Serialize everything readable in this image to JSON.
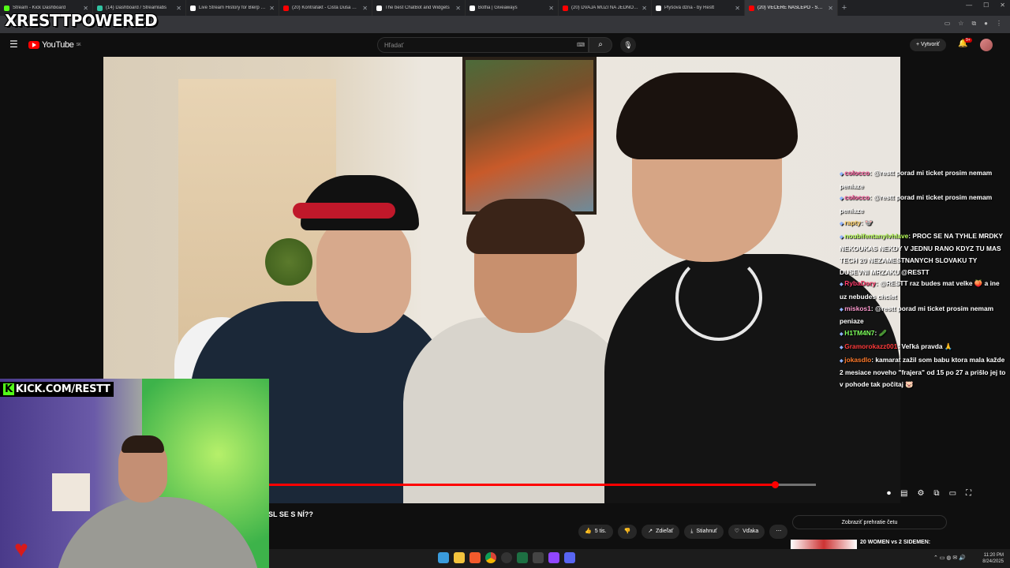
{
  "browser": {
    "tabs": [
      {
        "title": "Stream - Kick Dashboard",
        "favicon_color": "#53fc18"
      },
      {
        "title": "(14) Dashboard / Streamlabs",
        "favicon_color": "#31c3a2"
      },
      {
        "title": "Live Stream History for Blerp St...",
        "favicon_color": "#ffffff"
      },
      {
        "title": "(20) Kontrafakt - Čistá Duša pr...",
        "favicon_color": "#ff0000"
      },
      {
        "title": "The best ChatBot and Widgets",
        "favicon_color": "#ffffff"
      },
      {
        "title": "Botfia | Giveaways",
        "favicon_color": "#ffffff"
      },
      {
        "title": "(20) DVAJA MUŽI NA JEDNOM...",
        "favicon_color": "#ff0000"
      },
      {
        "title": "Plyšová dzña - by Restt",
        "favicon_color": "#ffffff"
      },
      {
        "title": "(20) VEČERE NASLEPO - STRČ...",
        "favicon_color": "#ff0000"
      }
    ],
    "active_tab": 8,
    "url_fragment": "PkC6RM"
  },
  "overlay": {
    "logo": "RESTTPOWERED",
    "kick_prefix": "K",
    "kick_text": "KICK.COM/RESTT"
  },
  "youtube": {
    "brand": "YouTube",
    "region": "SK",
    "search_placeholder": "Hľadať",
    "create_label": "Vytvoriť",
    "notifications": "9+"
  },
  "video": {
    "title": "SL SE S NÍ??",
    "progress": 0.925,
    "buffered": 1.0
  },
  "actions": {
    "likes": "5 tis.",
    "share": "Zdieľať",
    "download": "Stiahnuť",
    "thanks": "Vďaka"
  },
  "chat_replay": "Zobraziť prehratie četu",
  "related": {
    "title": "20 WOMEN vs 2 SIDEMEN:"
  },
  "chat": [
    {
      "user": "colocco",
      "color": "#ff5aa0",
      "text": "@restt porad mi ticket prosim nemam peniaze"
    },
    {
      "user": "colocco",
      "color": "#ff5aa0",
      "text": "@restt porad mi ticket prosim nemam peniaze"
    },
    {
      "user": "rapty",
      "color": "#ffd166",
      "text": "🐭"
    },
    {
      "user": "noubifentanylvhlave",
      "color": "#b9ff5a",
      "text": "PROC SE NA TYHLE MRDKY NEKOUKAS NEKDY V JEDNU RANO KDYZ TU MAS TECH 20 NEZAMESTNANYCH SLOVAKU TY DUSEVNI MRZAKU @RESTT"
    },
    {
      "user": "RybaDory",
      "color": "#ff3b6b",
      "text": "@RESTT raz budes mat velke 🍑 a ine uz nebudes chciet"
    },
    {
      "user": "miskos1",
      "color": "#ff9bd0",
      "text": "@restt porad mi ticket prosim nemam peniaze"
    },
    {
      "user": "H1TM4N7",
      "color": "#7CFF5A",
      "text": "🥒"
    },
    {
      "user": "Gramorokazz001",
      "color": "#ff3b3b",
      "text": "Veľká pravda 🙏"
    },
    {
      "user": "jokasdlo",
      "color": "#ff7a2b",
      "text": "kamarat zažil som babu ktora mala každe 2 mesiace noveho \"frajera\" od 15 po 27 a prišlo jej to v pohode tak počitaj 🐷"
    }
  ],
  "system": {
    "time": "11:20 PM",
    "date": "8/24/2025"
  }
}
